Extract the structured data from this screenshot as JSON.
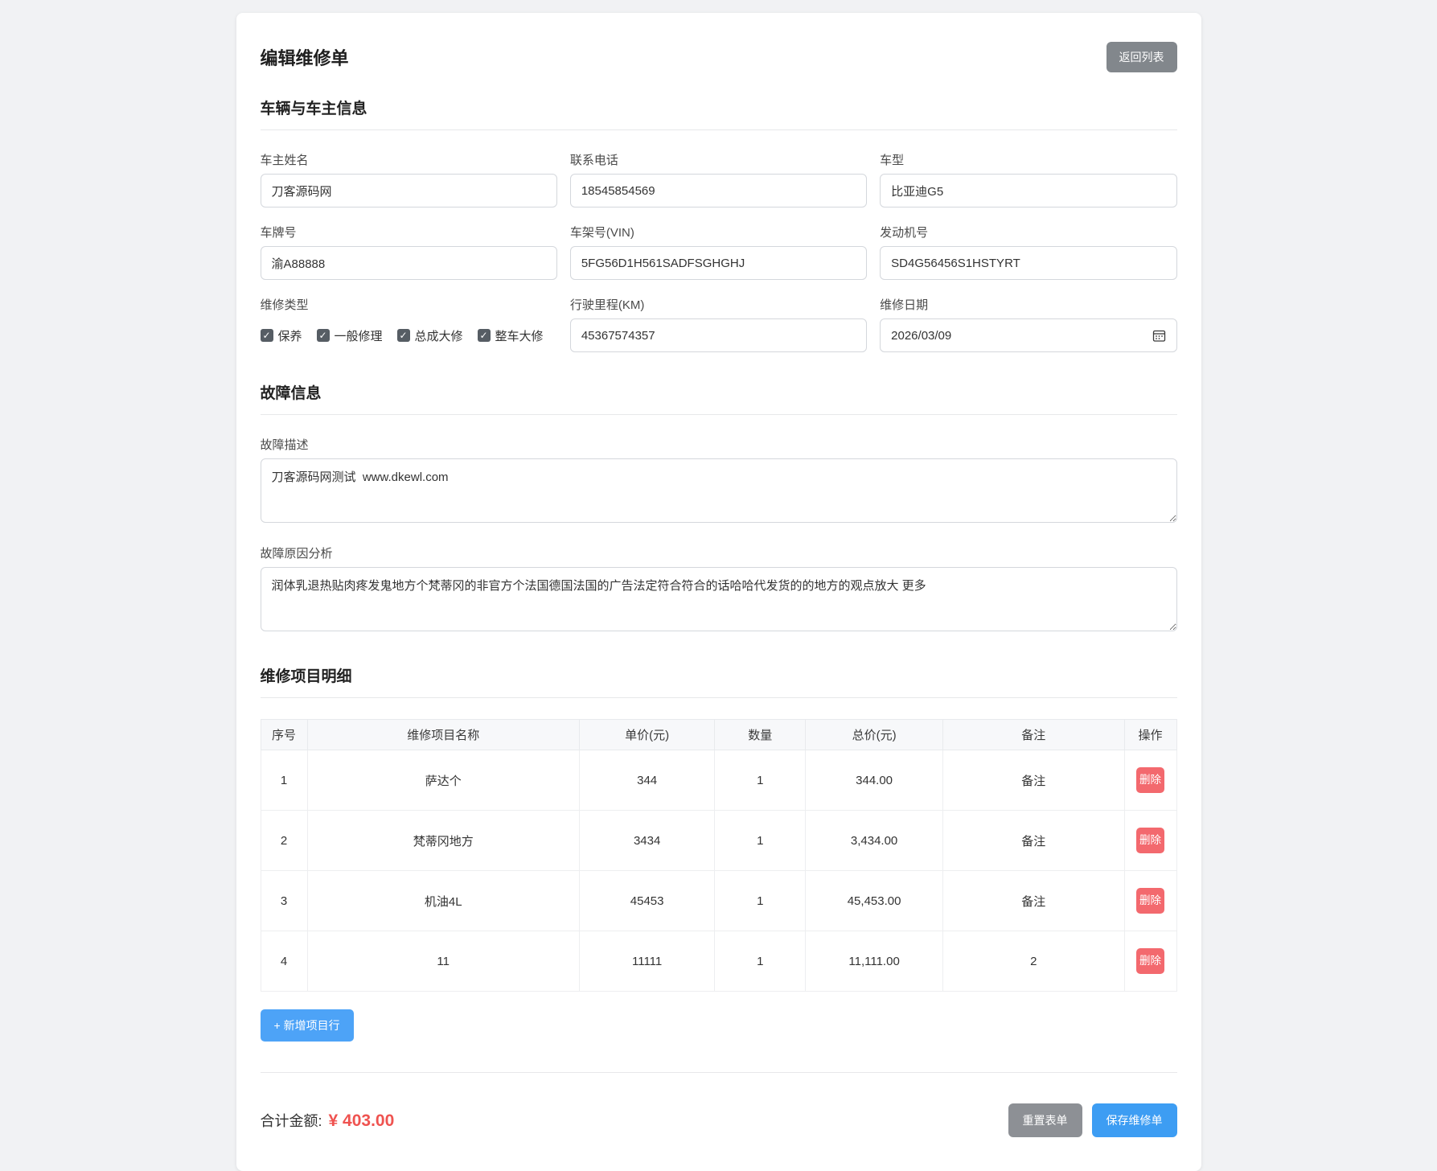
{
  "page": {
    "title": "编辑维修单",
    "back_button": "返回列表"
  },
  "vehicle_section": {
    "title": "车辆与车主信息",
    "fields": {
      "owner_name": {
        "label": "车主姓名",
        "value": "刀客源码网"
      },
      "phone": {
        "label": "联系电话",
        "value": "18545854569"
      },
      "model": {
        "label": "车型",
        "value": "比亚迪G5"
      },
      "plate": {
        "label": "车牌号",
        "value": "渝A88888"
      },
      "vin": {
        "label": "车架号(VIN)",
        "value": "5FG56D1H561SADFSGHGHJ"
      },
      "engine": {
        "label": "发动机号",
        "value": "SD4G56456S1HSTYRT"
      },
      "repair_type": {
        "label": "维修类型"
      },
      "mileage": {
        "label": "行驶里程(KM)",
        "value": "45367574357"
      },
      "date": {
        "label": "维修日期",
        "value": "2026/03/09"
      }
    },
    "repair_types": [
      {
        "label": "保养",
        "checked": true
      },
      {
        "label": "一般修理",
        "checked": true
      },
      {
        "label": "总成大修",
        "checked": true
      },
      {
        "label": "整车大修",
        "checked": true
      }
    ],
    "check_glyph": "✓"
  },
  "fault_section": {
    "title": "故障信息",
    "description": {
      "label": "故障描述",
      "value": "刀客源码网测试  www.dkewl.com"
    },
    "analysis": {
      "label": "故障原因分析",
      "value": "润体乳退热贴肉疼发鬼地方个梵蒂冈的非官方个法国德国法国的广告法定符合符合的话哈哈代发货的的地方的观点放大 更多"
    }
  },
  "items_section": {
    "title": "维修项目明细",
    "headers": {
      "seq": "序号",
      "name": "维修项目名称",
      "price": "单价(元)",
      "qty": "数量",
      "total": "总价(元)",
      "remark": "备注",
      "op": "操作"
    },
    "delete_label": "删除",
    "add_row_label": "+ 新增项目行",
    "rows": [
      {
        "seq": "1",
        "name": "萨达个",
        "price": "344",
        "qty": "1",
        "total": "344.00",
        "remark": "备注"
      },
      {
        "seq": "2",
        "name": "梵蒂冈地方",
        "price": "3434",
        "qty": "1",
        "total": "3,434.00",
        "remark": "备注"
      },
      {
        "seq": "3",
        "name": "机油4L",
        "price": "45453",
        "qty": "1",
        "total": "45,453.00",
        "remark": "备注"
      },
      {
        "seq": "4",
        "name": "11",
        "price": "11111",
        "qty": "1",
        "total": "11,111.00",
        "remark": "2"
      }
    ]
  },
  "footer": {
    "total_label": "合计金额:",
    "total_value": "¥ 403.00",
    "reset_button": "重置表单",
    "save_button": "保存维修单"
  },
  "colors": {
    "accent_blue": "#3d9df3",
    "add_blue": "#4da3f7",
    "danger_red": "#f3696e",
    "total_red": "#ef5350",
    "gray_button": "#82878c",
    "table_header_bg": "#f7f8fa"
  }
}
